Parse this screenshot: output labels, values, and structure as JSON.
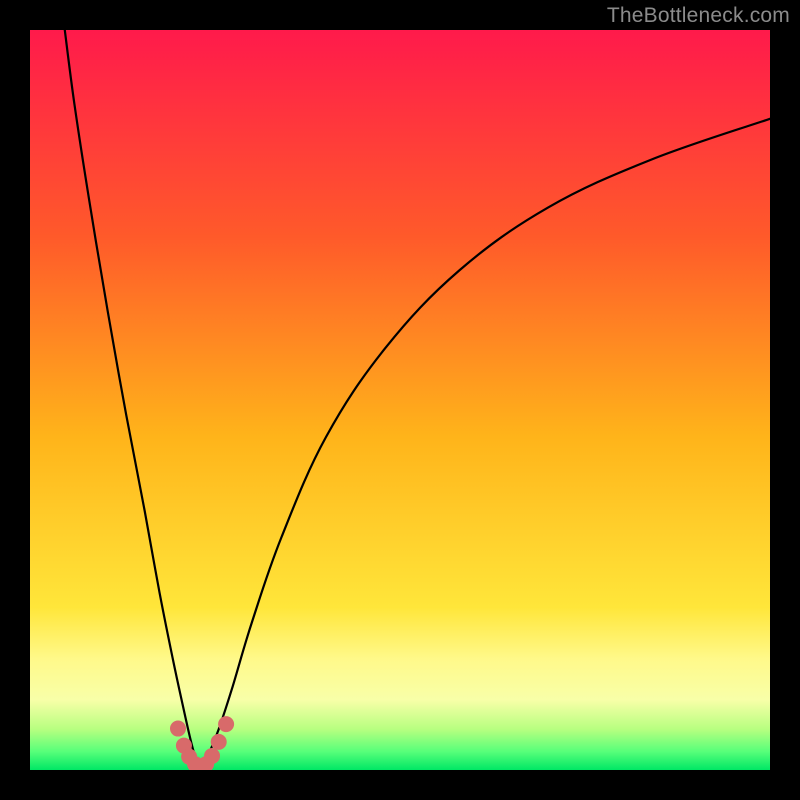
{
  "watermark": "TheBottleneck.com",
  "chart_data": {
    "type": "line",
    "title": "",
    "xlabel": "",
    "ylabel": "",
    "xlim": [
      0,
      100
    ],
    "ylim": [
      0,
      100
    ],
    "gradient_stops": [
      {
        "offset": 0,
        "color": "#ff1a4b"
      },
      {
        "offset": 0.28,
        "color": "#ff5a2a"
      },
      {
        "offset": 0.55,
        "color": "#ffb41a"
      },
      {
        "offset": 0.78,
        "color": "#ffe63a"
      },
      {
        "offset": 0.85,
        "color": "#fff98a"
      },
      {
        "offset": 0.905,
        "color": "#f8ffa8"
      },
      {
        "offset": 0.945,
        "color": "#b7ff80"
      },
      {
        "offset": 0.975,
        "color": "#58ff7a"
      },
      {
        "offset": 1.0,
        "color": "#00e765"
      }
    ],
    "series": [
      {
        "name": "left-branch",
        "x": [
          4.7,
          6.0,
          8.0,
          10.5,
          13.0,
          15.5,
          17.5,
          19.3,
          20.7,
          21.6,
          22.2,
          22.7,
          23.0
        ],
        "y": [
          100,
          90,
          77,
          62,
          48,
          35,
          24,
          15,
          8.5,
          4.5,
          2.2,
          0.9,
          0.2
        ]
      },
      {
        "name": "right-branch",
        "x": [
          23.0,
          23.5,
          24.3,
          25.5,
          27.3,
          30.0,
          34.0,
          40.0,
          48.0,
          58.0,
          70.0,
          84.0,
          100.0
        ],
        "y": [
          0.2,
          0.9,
          2.5,
          5.5,
          11.0,
          20.0,
          31.5,
          45.0,
          57.0,
          67.5,
          76.0,
          82.5,
          88.0
        ]
      }
    ],
    "markers": {
      "name": "trough-dots",
      "color": "#d86a6a",
      "radius": 8,
      "points": [
        {
          "x": 20.0,
          "y": 5.6
        },
        {
          "x": 20.8,
          "y": 3.3
        },
        {
          "x": 21.5,
          "y": 1.8
        },
        {
          "x": 22.3,
          "y": 0.8
        },
        {
          "x": 23.0,
          "y": 0.4
        },
        {
          "x": 23.8,
          "y": 0.8
        },
        {
          "x": 24.6,
          "y": 1.9
        },
        {
          "x": 25.5,
          "y": 3.8
        },
        {
          "x": 26.5,
          "y": 6.2
        }
      ]
    }
  }
}
